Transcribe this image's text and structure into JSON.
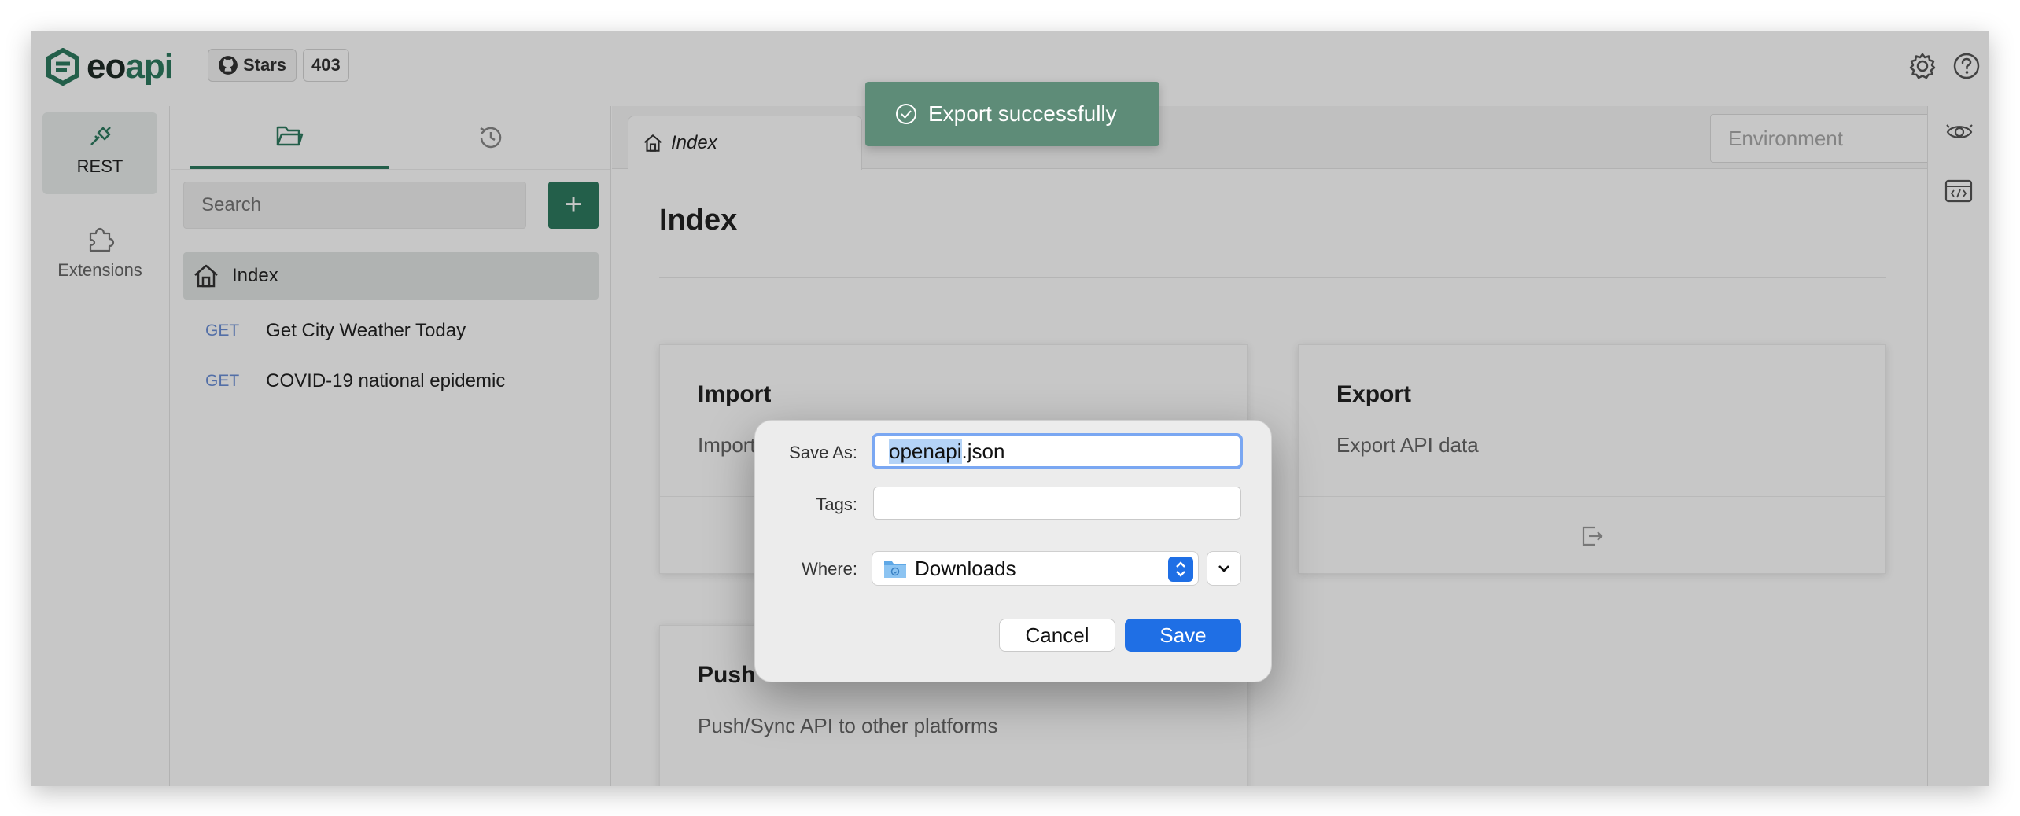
{
  "app": {
    "logo_prefix": "eo",
    "logo_suffix": "api",
    "github_stars_label": "Stars",
    "github_stars_count": "403"
  },
  "rail": {
    "items": [
      {
        "label": "REST",
        "icon": "plug-icon",
        "active": true
      },
      {
        "label": "Extensions",
        "icon": "puzzle-icon",
        "active": false
      }
    ]
  },
  "sidebar": {
    "tabs": [
      {
        "icon": "folder-icon",
        "active": true
      },
      {
        "icon": "history-icon",
        "active": false
      }
    ],
    "search_placeholder": "Search",
    "add_label": "+",
    "index_label": "Index",
    "apis": [
      {
        "method": "GET",
        "name": "Get City Weather Today"
      },
      {
        "method": "GET",
        "name": "COVID-19 national epidemic"
      }
    ]
  },
  "main": {
    "tab_label": "Index",
    "environment_placeholder": "Environment",
    "page_title": "Index",
    "cards": [
      {
        "title": "Import",
        "desc": "Import API data"
      },
      {
        "title": "Export",
        "desc": "Export API data"
      },
      {
        "title": "Push/Sync API to other platforms",
        "title_visible": "Push",
        "desc": "Push/Sync API to other platforms"
      }
    ]
  },
  "toast": {
    "message": "Export successfully"
  },
  "dialog": {
    "save_as_label": "Save As:",
    "filename_selected": "openapi",
    "filename_rest": ".json",
    "tags_label": "Tags:",
    "where_label": "Where:",
    "where_value": "Downloads",
    "cancel_label": "Cancel",
    "save_label": "Save"
  },
  "colors": {
    "brand": "#2d7a5f",
    "toast": "#5e8c78",
    "primary_button": "#1f6fe5",
    "method_get": "#6b8fd6"
  }
}
